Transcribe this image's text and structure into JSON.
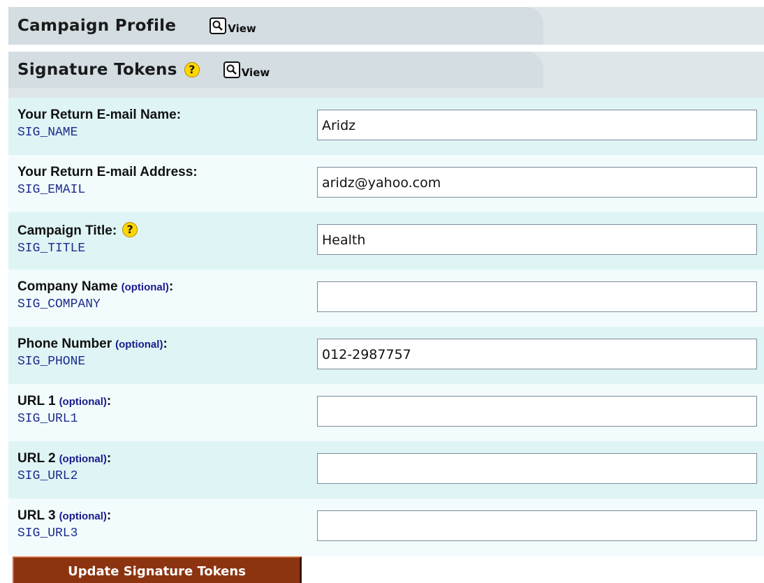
{
  "sections": {
    "campaign_profile": {
      "title": "Campaign Profile",
      "view_label": "View",
      "icon": "magnifier-icon"
    },
    "signature_tokens": {
      "title": "Signature Tokens",
      "view_label": "View",
      "help_glyph": "?",
      "icon": "magnifier-icon"
    }
  },
  "form": {
    "rows": [
      {
        "label": "Your Return E-mail Name",
        "optional": "",
        "colon": ":",
        "help": "",
        "token": "SIG_NAME",
        "value": "Aridz"
      },
      {
        "label": "Your Return E-mail Address",
        "optional": "",
        "colon": ":",
        "help": "",
        "token": "SIG_EMAIL",
        "value": "aridz@yahoo.com"
      },
      {
        "label": "Campaign Title",
        "optional": "",
        "colon": ":",
        "help": "?",
        "token": "SIG_TITLE",
        "value": "Health"
      },
      {
        "label": "Company Name",
        "optional": "(optional)",
        "colon": ":",
        "help": "",
        "token": "SIG_COMPANY",
        "value": ""
      },
      {
        "label": "Phone Number",
        "optional": "(optional)",
        "colon": ":",
        "help": "",
        "token": "SIG_PHONE",
        "value": "012-2987757"
      },
      {
        "label": "URL 1",
        "optional": "(optional)",
        "colon": ":",
        "help": "",
        "token": "SIG_URL1",
        "value": ""
      },
      {
        "label": "URL 2",
        "optional": "(optional)",
        "colon": ":",
        "help": "",
        "token": "SIG_URL2",
        "value": ""
      },
      {
        "label": "URL 3",
        "optional": "(optional)",
        "colon": ":",
        "help": "",
        "token": "SIG_URL3",
        "value": ""
      }
    ],
    "submit_label": "Update Signature Tokens"
  },
  "colors": {
    "tab_header_bg": "#d3dde2",
    "row_alt_bg": "#dff4f5",
    "row_plain_bg": "#f2fcfd",
    "token_color": "#1c2c8c",
    "optional_color": "#1a1a8c",
    "button_bg": "#8c3410",
    "help_icon": "#ffd700"
  }
}
